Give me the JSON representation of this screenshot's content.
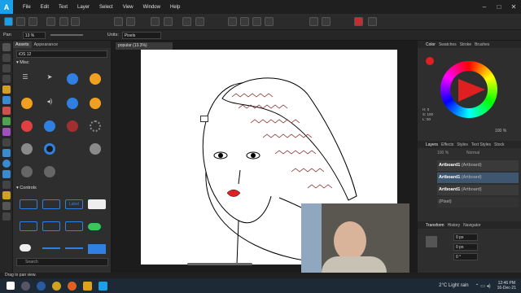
{
  "menubar": {
    "items": [
      "File",
      "Edit",
      "Text",
      "Layer",
      "Select",
      "View",
      "Window",
      "Help"
    ]
  },
  "context": {
    "tool_label": "Pan",
    "zoom": "13 %",
    "units_label": "Units:",
    "units_value": "Pixels"
  },
  "document": {
    "tab_title": "popular (13.3%)"
  },
  "assets": {
    "tabs": [
      "Assets",
      "Appearance"
    ],
    "category": "iOS 12",
    "section_misc": "Misc",
    "section_controls": "Controls",
    "search_placeholder": "Search",
    "small_label_left": "Label"
  },
  "right": {
    "color_tabs": [
      "Color",
      "Swatches",
      "Stroke",
      "Brushes"
    ],
    "hsl_h": "H: 0",
    "hsl_s": "S: 100",
    "hsl_l": "L: 50",
    "opacity": "100 %",
    "layer_tabs": [
      "Layers",
      "Effects",
      "Styles",
      "Text Styles",
      "Stock"
    ],
    "layer_opacity": "100 %",
    "blend_mode": "Normal",
    "layers": [
      {
        "name": "Artboard1",
        "type": "(Artboard)"
      },
      {
        "name": "Artboard1",
        "type": "(Artboard)"
      },
      {
        "name": "Artboard1",
        "type": "(Artboard)"
      }
    ],
    "pixel_layer": "(Pixel)",
    "transform_tabs": [
      "Transform",
      "History",
      "Navigator"
    ],
    "transform_value": "0 px",
    "transform_angle": "0 °"
  },
  "status": {
    "text": "Drag to pan view."
  },
  "taskbar": {
    "weather": "2°C  Light rain",
    "time": "12:46 PM",
    "date": "16-Dec-21"
  },
  "colors": {
    "accent": "#1aa0e8",
    "selected_layer": "#3f5670"
  }
}
